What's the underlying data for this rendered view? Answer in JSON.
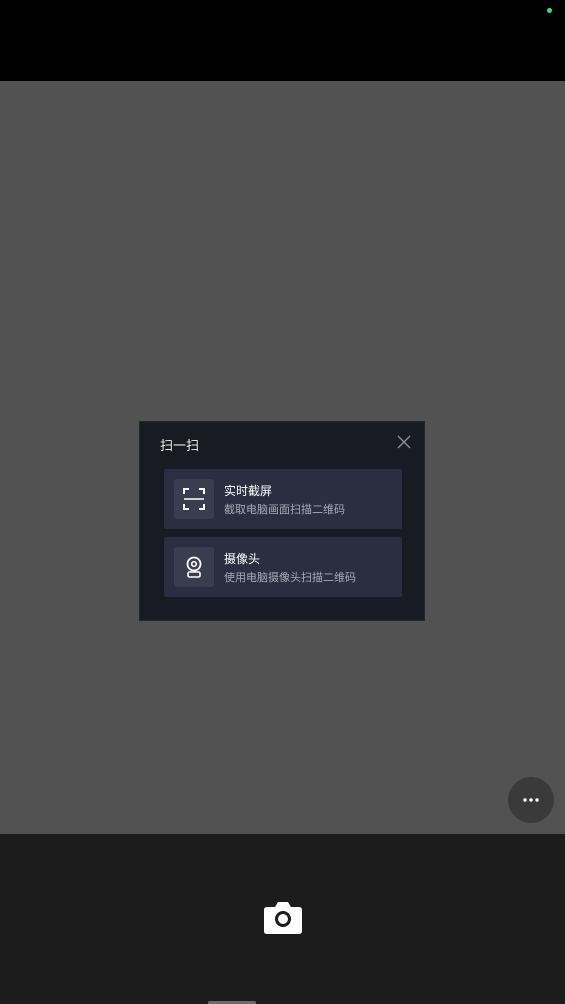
{
  "dialog": {
    "title": "扫一扫",
    "options": [
      {
        "title": "实时截屏",
        "desc": "截取电脑画面扫描二维码",
        "icon": "scan-frame-icon"
      },
      {
        "title": "摄像头",
        "desc": "使用电脑摄像头扫描二维码",
        "icon": "webcam-icon"
      }
    ],
    "close_icon": "close-icon"
  },
  "status": {
    "indicator_color": "#3ddc84"
  },
  "more_button": {
    "icon": "more-dots-icon"
  },
  "shutter": {
    "icon": "camera-icon"
  },
  "colors": {
    "viewport": "#525252",
    "dialog_bg": "#181a24",
    "option_bg": "#2b2d40",
    "bottom_bar": "#1c1c1c"
  }
}
